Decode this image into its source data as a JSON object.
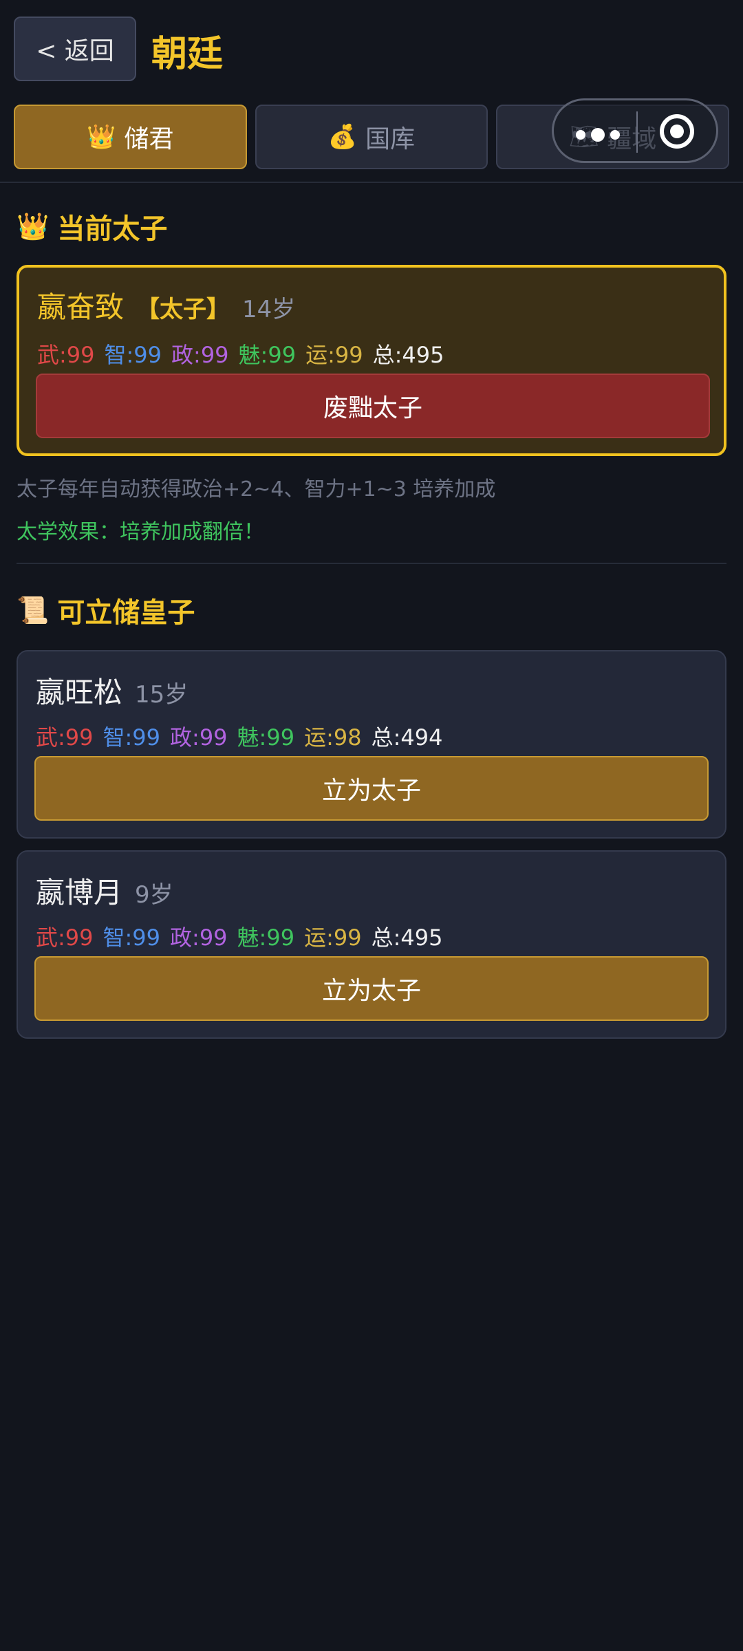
{
  "header": {
    "back_label": "< 返回",
    "title": "朝廷"
  },
  "tabs": [
    {
      "label": "储君",
      "icon": "👑",
      "active": true
    },
    {
      "label": "国库",
      "icon": "💰",
      "active": false
    },
    {
      "label": "疆域",
      "icon": "🗺",
      "active": false
    }
  ],
  "current_section": {
    "title": "当前太子",
    "icon": "👑",
    "heir": {
      "name": "嬴奋致",
      "badge": "【太子】",
      "age": "14岁",
      "stats": {
        "wu": "武:99",
        "zhi": "智:99",
        "zheng": "政:99",
        "mei": "魅:99",
        "yun": "运:99",
        "zong": "总:495"
      },
      "action": "废黜太子"
    },
    "hint": "太子每年自动获得政治+2~4、智力+1~3 培养加成",
    "effect": "太学效果：培养加成翻倍！"
  },
  "candidates_section": {
    "title": "可立储皇子",
    "icon": "📜",
    "items": [
      {
        "name": "嬴旺松",
        "age": "15岁",
        "stats": {
          "wu": "武:99",
          "zhi": "智:99",
          "zheng": "政:99",
          "mei": "魅:99",
          "yun": "运:98",
          "zong": "总:494"
        },
        "action": "立为太子"
      },
      {
        "name": "嬴博月",
        "age": "9岁",
        "stats": {
          "wu": "武:99",
          "zhi": "智:99",
          "zheng": "政:99",
          "mei": "魅:99",
          "yun": "运:99",
          "zong": "总:495"
        },
        "action": "立为太子"
      }
    ]
  }
}
